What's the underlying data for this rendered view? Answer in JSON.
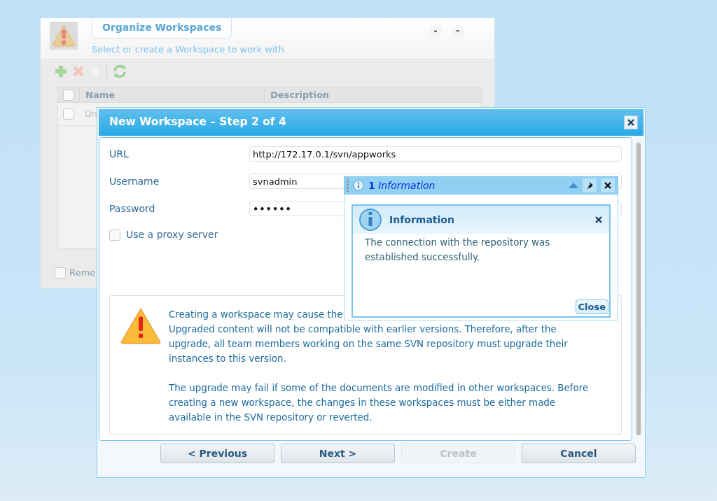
{
  "background_window": {
    "title": "Organize Workspaces",
    "subtitle": "Select or create a Workspace to work with",
    "table": {
      "columns": [
        "Name",
        "Description"
      ],
      "header_checked": false,
      "rows": [
        {
          "name": "Un",
          "checked": false
        }
      ]
    },
    "remember": {
      "label": "Reme",
      "checked": false
    }
  },
  "dialog": {
    "title": "New Workspace – Step 2 of 4",
    "fields": [
      {
        "label": "URL",
        "value": "http://172.17.0.1/svn/appworks",
        "kind": "text"
      },
      {
        "label": "Username",
        "value": "svnadmin",
        "kind": "text"
      },
      {
        "label": "Password",
        "value": "••••••",
        "kind": "password"
      }
    ],
    "proxy": {
      "label": "Use a proxy server",
      "checked": false
    },
    "warning": {
      "paragraphs": [
        [
          "Creating a workspace may cause the",
          "Upgraded content will not be compatible with earlier versions. Therefore, after the",
          "upgrade, all team members working on the same SVN repository must upgrade their",
          "instances to this version."
        ],
        [
          "The upgrade may fail if some of the documents are modified in other workspaces. Before",
          "creating a new workspace, the changes in these workspaces must be either made",
          "available in the SVN repository or reverted."
        ]
      ]
    },
    "buttons": [
      {
        "label": "< Previous",
        "disabled": false
      },
      {
        "label": "Next >",
        "disabled": false
      },
      {
        "label": "Create",
        "disabled": true
      },
      {
        "label": "Cancel",
        "disabled": false
      }
    ]
  },
  "notification": {
    "title": "**1** *Information*",
    "message_box": {
      "title": "Information",
      "message": "The connection with the repository was established successfully.",
      "button": "Close"
    }
  }
}
